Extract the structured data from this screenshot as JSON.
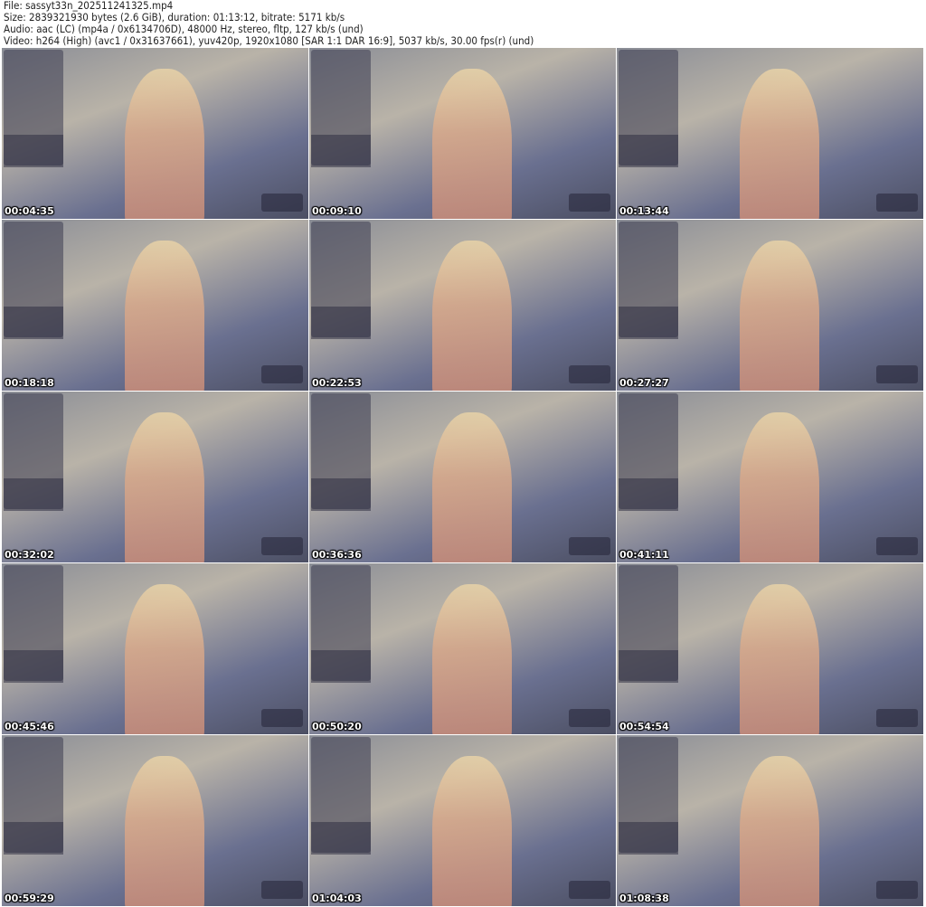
{
  "header": {
    "file": "File: sassyt33n_202511241325.mp4",
    "size": "Size: 2839321930 bytes (2.6 GiB), duration: 01:13:12, bitrate: 5171 kb/s",
    "audio": "Audio: aac (LC) (mp4a / 0x6134706D), 48000 Hz, stereo, fltp, 127 kb/s (und)",
    "video": "Video: h264 (High) (avc1 / 0x31637661), yuv420p, 1920x1080 [SAR 1:1 DAR 16:9], 5037 kb/s, 30.00 fps(r) (und)"
  },
  "thumbnails": [
    {
      "timestamp": "00:04:35"
    },
    {
      "timestamp": "00:09:10"
    },
    {
      "timestamp": "00:13:44"
    },
    {
      "timestamp": "00:18:18"
    },
    {
      "timestamp": "00:22:53"
    },
    {
      "timestamp": "00:27:27"
    },
    {
      "timestamp": "00:32:02"
    },
    {
      "timestamp": "00:36:36"
    },
    {
      "timestamp": "00:41:11"
    },
    {
      "timestamp": "00:45:46"
    },
    {
      "timestamp": "00:50:20"
    },
    {
      "timestamp": "00:54:54"
    },
    {
      "timestamp": "00:59:29"
    },
    {
      "timestamp": "01:04:03"
    },
    {
      "timestamp": "01:08:38"
    }
  ]
}
